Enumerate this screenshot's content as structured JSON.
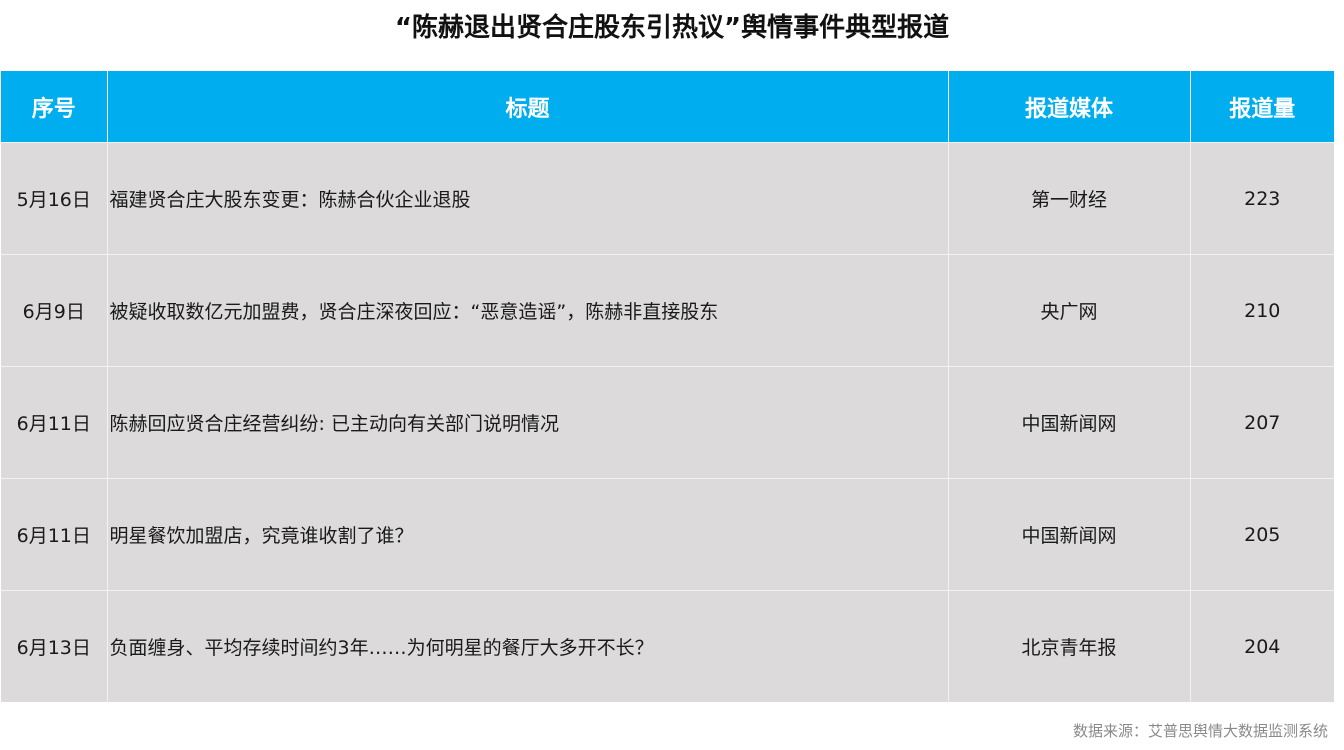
{
  "title": "“陈赫退出贤合庄股东引热议”舆情事件典型报道",
  "table": {
    "headers": {
      "date": "序号",
      "headline": "标题",
      "media": "报道媒体",
      "count": "报道量"
    },
    "rows": [
      {
        "date": "5月16日",
        "headline": "福建贤合庄大股东变更：陈赫合伙企业退股",
        "media": "第一财经",
        "count": "223"
      },
      {
        "date": "6月9日",
        "headline": "被疑收取数亿元加盟费，贤合庄深夜回应：“恶意造谣”，陈赫非直接股东",
        "media": "央广网",
        "count": "210"
      },
      {
        "date": "6月11日",
        "headline": "陈赫回应贤合庄经营纠纷: 已主动向有关部门说明情况",
        "media": "中国新闻网",
        "count": "207"
      },
      {
        "date": "6月11日",
        "headline": "明星餐饮加盟店，究竟谁收割了谁？",
        "media": "中国新闻网",
        "count": "205"
      },
      {
        "date": "6月13日",
        "headline": "负面缠身、平均存续时间约3年……为何明星的餐厅大多开不长？",
        "media": "北京青年报",
        "count": "204"
      }
    ]
  },
  "footer": {
    "source": "数据来源：艾普思舆情大数据监测系统"
  }
}
